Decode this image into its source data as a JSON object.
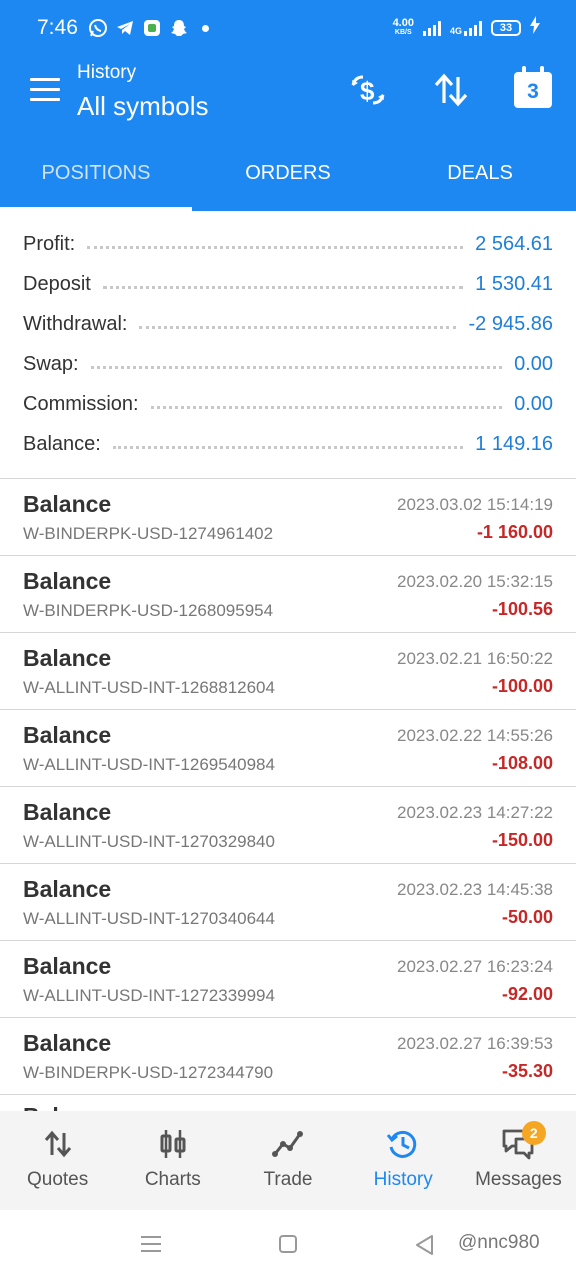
{
  "status_bar": {
    "time": "7:46",
    "net_speed": "4.00",
    "net_unit": "KB/S",
    "net_type": "4G",
    "battery": "33"
  },
  "app_bar": {
    "subtitle": "History",
    "title": "All symbols",
    "calendar_day": "3"
  },
  "tabs": [
    {
      "label": "POSITIONS"
    },
    {
      "label": "ORDERS"
    },
    {
      "label": "DEALS"
    }
  ],
  "summary": [
    {
      "label": "Profit:",
      "value": "2 564.61"
    },
    {
      "label": "Deposit",
      "value": "1 530.41"
    },
    {
      "label": "Withdrawal:",
      "value": "-2 945.86"
    },
    {
      "label": "Swap:",
      "value": "0.00"
    },
    {
      "label": "Commission:",
      "value": "0.00"
    },
    {
      "label": "Balance:",
      "value": "1 149.16"
    }
  ],
  "deals": [
    {
      "type": "Balance",
      "comment": "W-BINDERPK-USD-1274961402",
      "time": "2023.03.02 15:14:19",
      "amount": "-1 160.00"
    },
    {
      "type": "Balance",
      "comment": "W-BINDERPK-USD-1268095954",
      "time": "2023.02.20 15:32:15",
      "amount": "-100.56"
    },
    {
      "type": "Balance",
      "comment": "W-ALLINT-USD-INT-1268812604",
      "time": "2023.02.21 16:50:22",
      "amount": "-100.00"
    },
    {
      "type": "Balance",
      "comment": "W-ALLINT-USD-INT-1269540984",
      "time": "2023.02.22 14:55:26",
      "amount": "-108.00"
    },
    {
      "type": "Balance",
      "comment": "W-ALLINT-USD-INT-1270329840",
      "time": "2023.02.23 14:27:22",
      "amount": "-150.00"
    },
    {
      "type": "Balance",
      "comment": "W-ALLINT-USD-INT-1270340644",
      "time": "2023.02.23 14:45:38",
      "amount": "-50.00"
    },
    {
      "type": "Balance",
      "comment": "W-ALLINT-USD-INT-1272339994",
      "time": "2023.02.27 16:23:24",
      "amount": "-92.00"
    },
    {
      "type": "Balance",
      "comment": "W-BINDERPK-USD-1272344790",
      "time": "2023.02.27 16:39:53",
      "amount": "-35.30"
    }
  ],
  "partial_row_type": "Balance",
  "bottom_nav": [
    {
      "label": "Quotes",
      "icon": "quotes-arrows-icon"
    },
    {
      "label": "Charts",
      "icon": "candlestick-icon"
    },
    {
      "label": "Trade",
      "icon": "trade-line-icon"
    },
    {
      "label": "History",
      "icon": "history-clock-icon"
    },
    {
      "label": "Messages",
      "icon": "messages-icon",
      "badge": "2"
    }
  ],
  "watermark": "@nnc980",
  "colors": {
    "primary": "#1e88f2",
    "positive_value": "#1e7fd8",
    "negative_value": "#c62828",
    "badge": "#f5a623"
  }
}
